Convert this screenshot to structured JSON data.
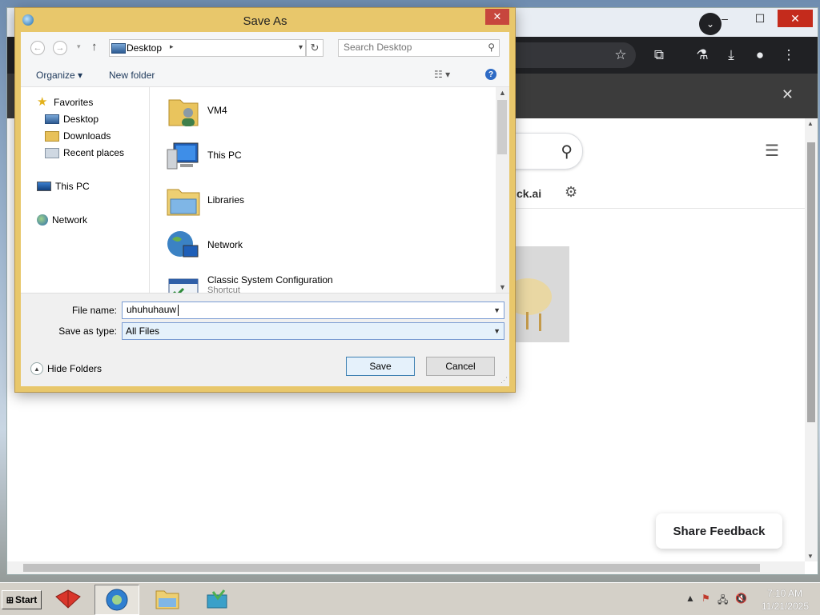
{
  "dialog": {
    "title": "Save As",
    "close_glyph": "✕",
    "nav": {
      "back_glyph": "←",
      "forward_glyph": "→",
      "up_glyph": "↑",
      "location": "Desktop",
      "search_placeholder": "Search Desktop"
    },
    "commands": {
      "organize": "Organize ▾",
      "new_folder": "New folder"
    },
    "nav_pane": {
      "favorites": "Favorites",
      "desktop": "Desktop",
      "downloads": "Downloads",
      "recent_places": "Recent places",
      "this_pc": "This PC",
      "network": "Network"
    },
    "files": [
      {
        "name": "VM4",
        "subtitle": ""
      },
      {
        "name": "This PC",
        "subtitle": ""
      },
      {
        "name": "Libraries",
        "subtitle": ""
      },
      {
        "name": "Network",
        "subtitle": ""
      },
      {
        "name": "Classic System Configuration",
        "subtitle": "Shortcut"
      }
    ],
    "file_name_label": "File name:",
    "file_name_value": "uhuhuhauw",
    "save_type_label": "Save as type:",
    "save_type_value": "All Files",
    "hide_folders": "Hide Folders",
    "save_button": "Save",
    "cancel_button": "Cancel"
  },
  "browser": {
    "tab_partial_text": "ck.ai",
    "share_feedback": "Share Feedback"
  },
  "taskbar": {
    "start_label": "Start",
    "time": "7:10 AM",
    "date": "11/21/2025"
  },
  "colors": {
    "dialog_frame": "#e8c76b",
    "close_red": "#c7463d",
    "browser_dark": "#202124"
  }
}
